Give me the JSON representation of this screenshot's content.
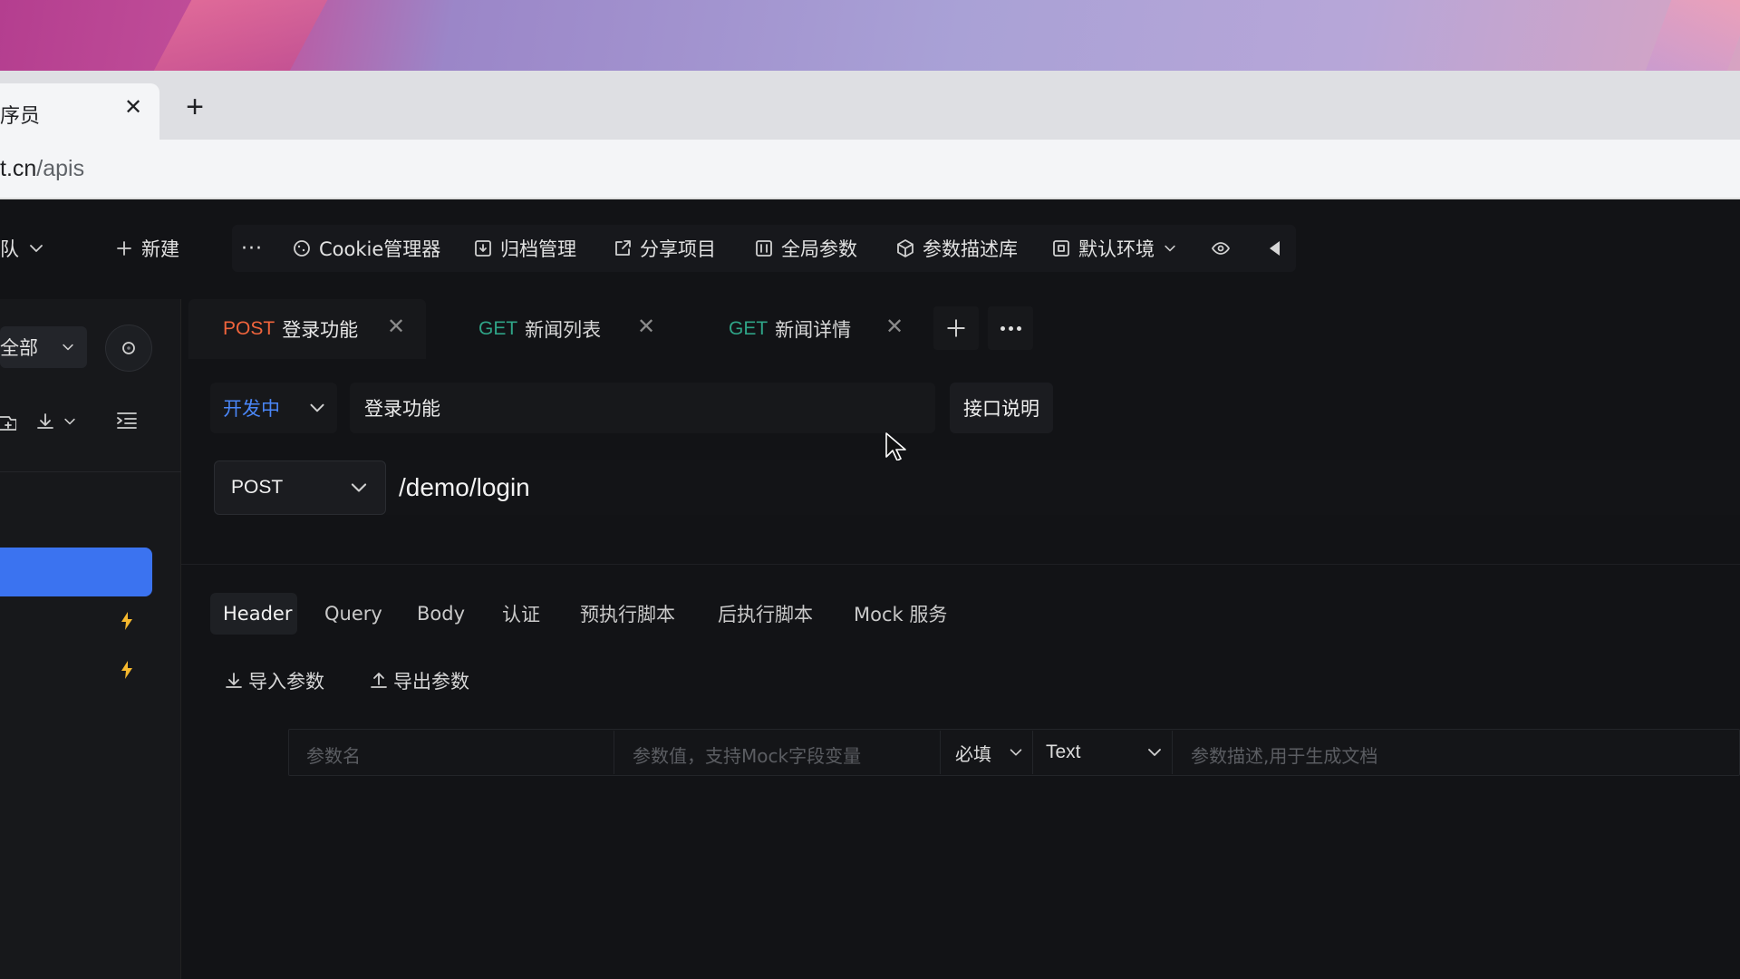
{
  "browser": {
    "tab_title": "序员",
    "close_glyph": "✕",
    "new_tab_glyph": "+",
    "url_host": "t.cn",
    "url_path": "/apis"
  },
  "toolbar": {
    "team_label": "队",
    "new_label": "新建",
    "more_glyph": "···",
    "cookie_label": "Cookie管理器",
    "archive_label": "归档管理",
    "share_label": "分享项目",
    "global_params_label": "全局参数",
    "param_desc_label": "参数描述库",
    "env_label": "默认环境"
  },
  "sidebar": {
    "filter_label": "全部"
  },
  "request_tabs": [
    {
      "method": "POST",
      "name": "登录功能"
    },
    {
      "method": "GET",
      "name": "新闻列表"
    },
    {
      "method": "GET",
      "name": "新闻详情"
    }
  ],
  "api": {
    "status": "开发中",
    "name": "登录功能",
    "doc_button": "接口说明",
    "method": "POST",
    "path": "/demo/login"
  },
  "sub_tabs": [
    "Header",
    "Query",
    "Body",
    "认证",
    "预执行脚本",
    "后执行脚本",
    "Mock 服务"
  ],
  "actions": {
    "import_label": "导入参数",
    "export_label": "导出参数"
  },
  "param_row": {
    "name_placeholder": "参数名",
    "value_placeholder": "参数值，支持Mock字段变量",
    "required_label": "必填",
    "type_label": "Text",
    "desc_placeholder": "参数描述,用于生成文档"
  },
  "colors": {
    "accent": "#3b73f0",
    "post": "#f0643c",
    "get": "#2fa487",
    "status": "#4a86f7"
  }
}
